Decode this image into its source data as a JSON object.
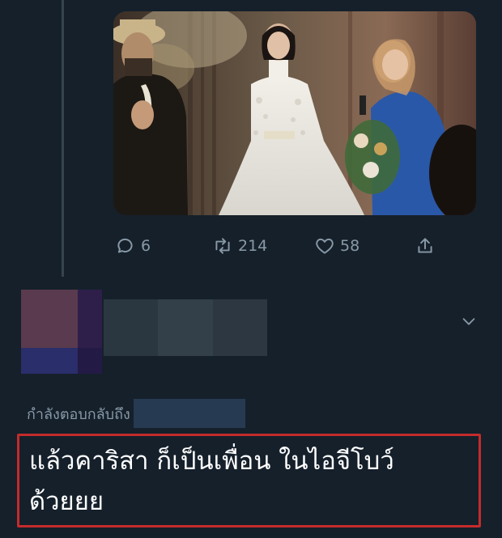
{
  "tweet": {
    "stats": {
      "replies": "6",
      "retweets": "214",
      "likes": "58"
    }
  },
  "reply": {
    "replying_to_label": "กำลังตอบกลับถึง",
    "text": "แล้วคาริสา ก็เป็นเพื่อน ในไอจีโบว์\nด้วยยย"
  },
  "icons": {
    "reply": "speech-bubble-icon",
    "retweet": "retweet-icon",
    "like": "heart-icon",
    "share": "share-icon",
    "more": "chevron-down-icon"
  },
  "colors": {
    "background": "#15202b",
    "muted_text": "#8899a6",
    "highlight_border": "#c42b2b",
    "thread_line": "#38444d"
  }
}
